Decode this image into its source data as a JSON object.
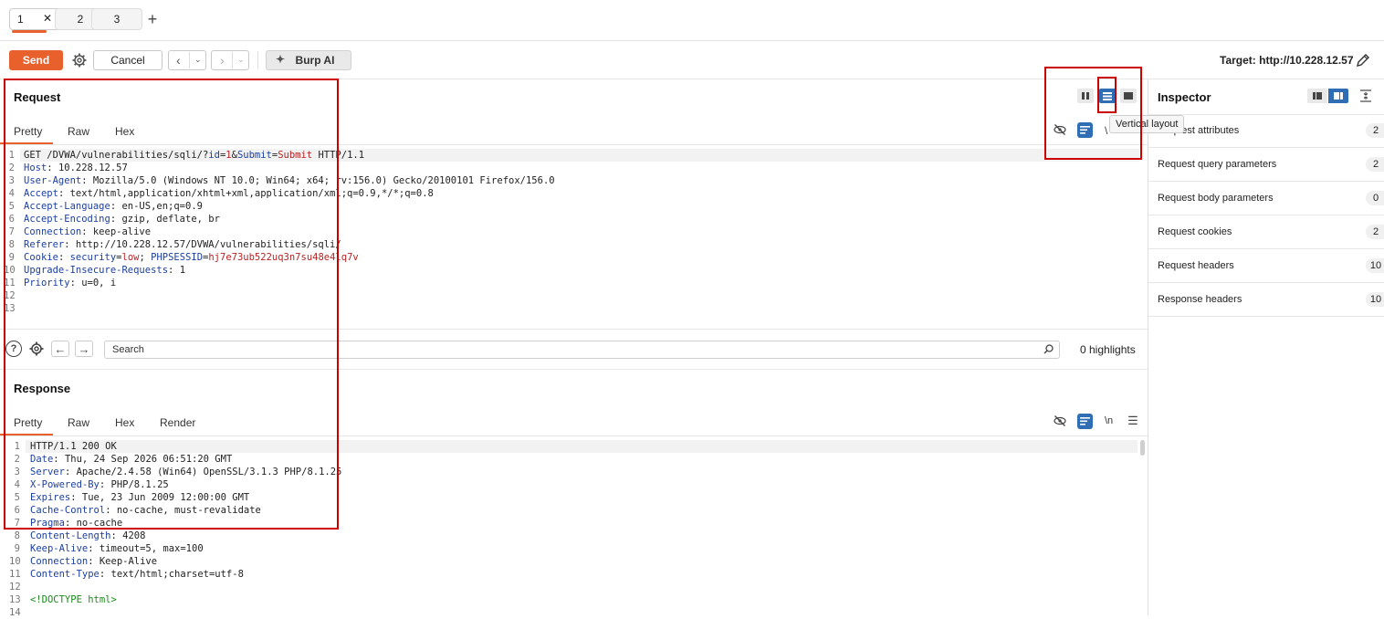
{
  "tabs": [
    {
      "label": "1",
      "active": true
    },
    {
      "label": "2",
      "active": false
    },
    {
      "label": "3",
      "active": false
    }
  ],
  "toolbar": {
    "send": "Send",
    "cancel": "Cancel",
    "burp_ai": "Burp AI",
    "target": "Target: http://10.228.12.57"
  },
  "request": {
    "title": "Request",
    "tabs": [
      "Pretty",
      "Raw",
      "Hex"
    ],
    "lines": [
      {
        "n": "1",
        "html": "GET /DVWA/vulnerabilities/sqli/?<span class='p'>id</span>=<span class='pv'>1</span>&amp;<span class='p'>Submit</span>=<span class='pv'>Submit</span> HTTP/1.1"
      },
      {
        "n": "2",
        "html": "<span class='k'>Host</span>: 10.228.12.57"
      },
      {
        "n": "3",
        "html": "<span class='k'>User-Agent</span>: Mozilla/5.0 (Windows NT 10.0; Win64; x64; rv:156.0) Gecko/20100101 Firefox/156.0"
      },
      {
        "n": "4",
        "html": "<span class='k'>Accept</span>: text/html,application/xhtml+xml,application/xml;q=0.9,*/*;q=0.8"
      },
      {
        "n": "5",
        "html": "<span class='k'>Accept-Language</span>: en-US,en;q=0.9"
      },
      {
        "n": "6",
        "html": "<span class='k'>Accept-Encoding</span>: gzip, deflate, br"
      },
      {
        "n": "7",
        "html": "<span class='k'>Connection</span>: keep-alive"
      },
      {
        "n": "8",
        "html": "<span class='k'>Referer</span>: http://10.228.12.57/DVWA/vulnerabilities/sqli/"
      },
      {
        "n": "9",
        "html": "<span class='k'>Cookie</span>: <span class='p'>security</span>=<span class='pv'>low</span>; <span class='p'>PHPSESSID</span>=<span class='pv'>hj7e73ub522uq3n7su48e4lq7v</span>"
      },
      {
        "n": "10",
        "html": "<span class='k'>Upgrade-Insecure-Requests</span>: 1"
      },
      {
        "n": "11",
        "html": "<span class='k'>Priority</span>: u=0, i"
      },
      {
        "n": "12",
        "html": ""
      },
      {
        "n": "13",
        "html": ""
      }
    ]
  },
  "search": {
    "placeholder": "Search",
    "highlights": "0 highlights"
  },
  "response": {
    "title": "Response",
    "tabs": [
      "Pretty",
      "Raw",
      "Hex",
      "Render"
    ],
    "newline_toggle": "\\n",
    "lines": [
      {
        "n": "1",
        "html": "HTTP/1.1 200 OK"
      },
      {
        "n": "2",
        "html": "<span class='k'>Date</span>: Thu, 24 Sep 2026 06:51:20 GMT"
      },
      {
        "n": "3",
        "html": "<span class='k'>Server</span>: Apache/2.4.58 (Win64) OpenSSL/3.1.3 PHP/8.1.25"
      },
      {
        "n": "4",
        "html": "<span class='k'>X-Powered-By</span>: PHP/8.1.25"
      },
      {
        "n": "5",
        "html": "<span class='k'>Expires</span>: Tue, 23 Jun 2009 12:00:00 GMT"
      },
      {
        "n": "6",
        "html": "<span class='k'>Cache-Control</span>: no-cache, must-revalidate"
      },
      {
        "n": "7",
        "html": "<span class='k'>Pragma</span>: no-cache"
      },
      {
        "n": "8",
        "html": "<span class='k'>Content-Length</span>: 4208"
      },
      {
        "n": "9",
        "html": "<span class='k'>Keep-Alive</span>: timeout=5, max=100"
      },
      {
        "n": "10",
        "html": "<span class='k'>Connection</span>: Keep-Alive"
      },
      {
        "n": "11",
        "html": "<span class='k'>Content-Type</span>: text/html;charset=utf-8"
      },
      {
        "n": "12",
        "html": ""
      },
      {
        "n": "13",
        "html": "<span class='g'>&lt;!DOCTYPE html&gt;</span>"
      },
      {
        "n": "14",
        "html": ""
      }
    ]
  },
  "inspector": {
    "title": "Inspector",
    "tooltip": "Vertical layout",
    "rows": [
      {
        "label": "Request attributes",
        "count": "2"
      },
      {
        "label": "Request query parameters",
        "count": "2"
      },
      {
        "label": "Request body parameters",
        "count": "0"
      },
      {
        "label": "Request cookies",
        "count": "2"
      },
      {
        "label": "Request headers",
        "count": "10"
      },
      {
        "label": "Response headers",
        "count": "10"
      }
    ]
  },
  "colors": {
    "accent": "#e8602c",
    "highlight_box": "#cc0000",
    "toggle_blue": "#2f6db5"
  }
}
